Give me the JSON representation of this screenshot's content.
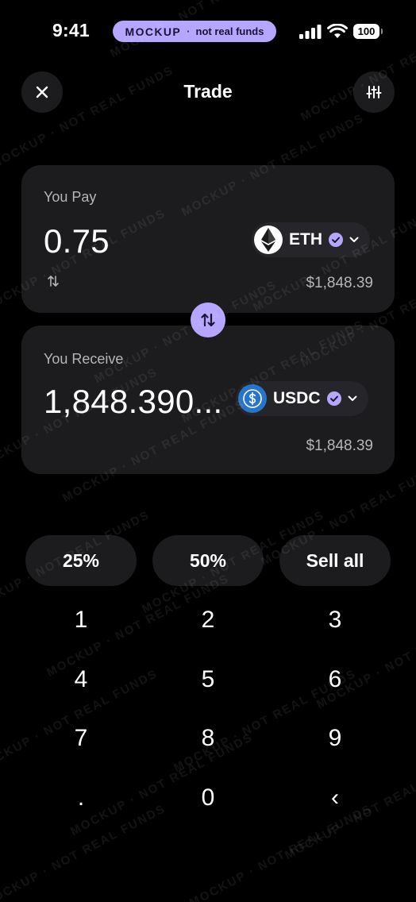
{
  "status_bar": {
    "time": "9:41",
    "badge_strong": "MOCKUP",
    "badge_separator": "·",
    "badge_text": "not real funds",
    "battery": "100"
  },
  "header": {
    "title": "Trade",
    "close_icon": "close-icon",
    "settings_icon": "sliders-icon"
  },
  "pay": {
    "label": "You Pay",
    "amount": "0.75",
    "token": "ETH",
    "fiat_value": "$1,848.39"
  },
  "receive": {
    "label": "You Receive",
    "amount": "1,848.390...",
    "token": "USDC",
    "fiat_value": "$1,848.39"
  },
  "percent_buttons": [
    "25%",
    "50%",
    "Sell all"
  ],
  "keypad": [
    "1",
    "2",
    "3",
    "4",
    "5",
    "6",
    "7",
    "8",
    "9",
    ".",
    "0",
    "‹"
  ],
  "watermark": "MOCKUP · NOT REAL FUNDS",
  "colors": {
    "accent": "#b7a6ff",
    "card": "#1c1c1e",
    "background": "#000000",
    "usdc": "#2775ca"
  }
}
